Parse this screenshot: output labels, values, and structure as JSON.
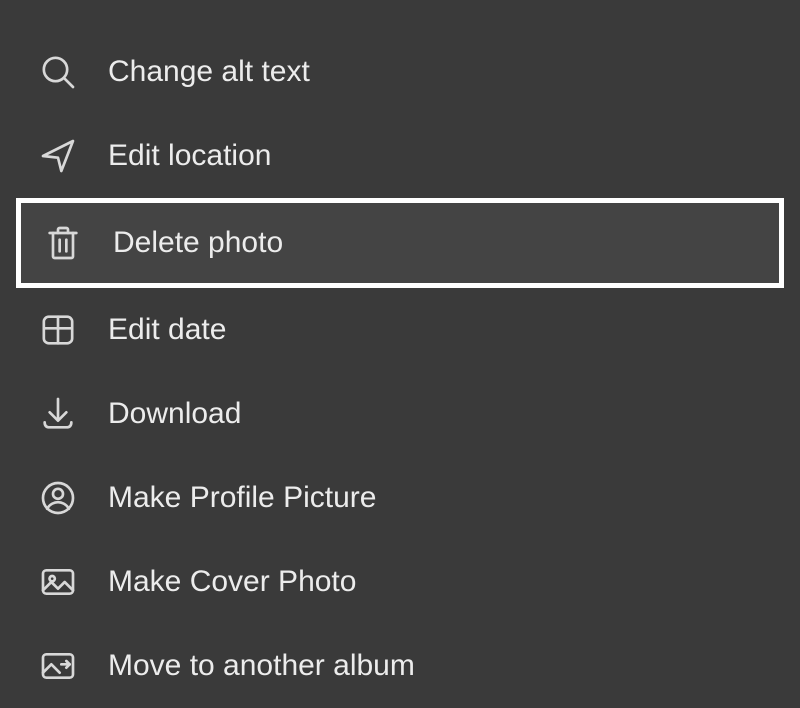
{
  "menu": {
    "items": [
      {
        "label": "Change alt text"
      },
      {
        "label": "Edit location"
      },
      {
        "label": "Delete photo"
      },
      {
        "label": "Edit date"
      },
      {
        "label": "Download"
      },
      {
        "label": "Make Profile Picture"
      },
      {
        "label": "Make Cover Photo"
      },
      {
        "label": "Move to another album"
      }
    ]
  }
}
